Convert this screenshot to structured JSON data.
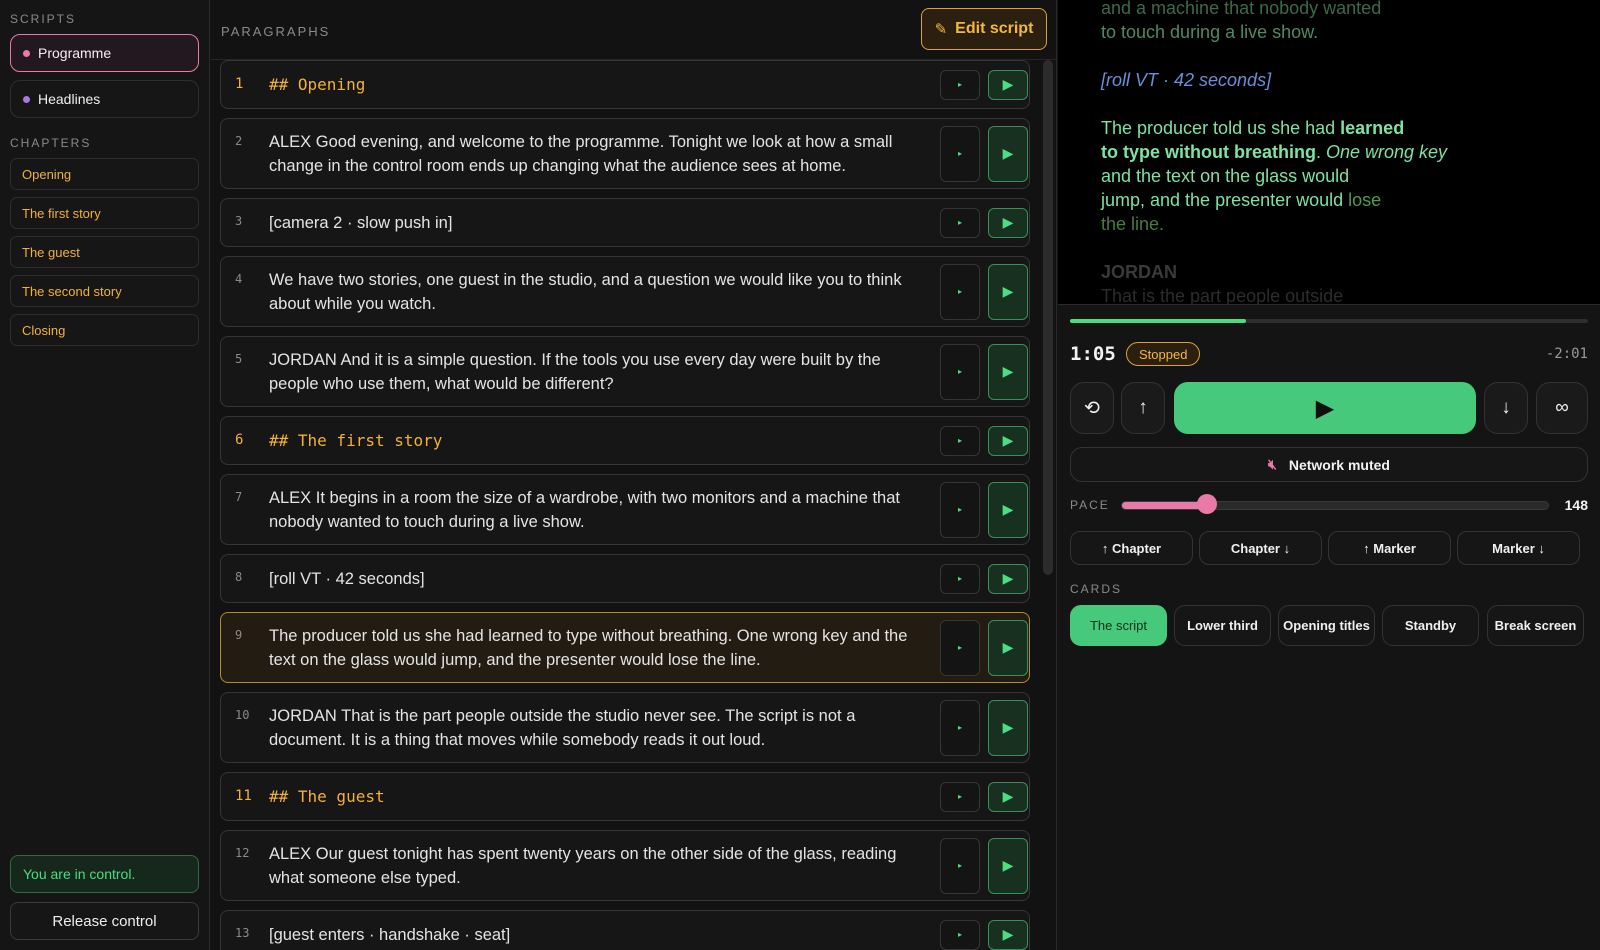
{
  "colors": {
    "accent_green": "#4ade80",
    "accent_pink": "#e879a9",
    "accent_purple": "#a678e0",
    "accent_amber": "#f2b13a",
    "background": "#121212"
  },
  "sidebar": {
    "scripts_label": "SCRIPTS",
    "scripts": [
      {
        "label": "Programme",
        "active": true,
        "dot_color": "#e879a9"
      },
      {
        "label": "Headlines",
        "active": false,
        "dot_color": "#a678e0"
      }
    ],
    "chapters_label": "CHAPTERS",
    "chapters": [
      "Opening",
      "The first story",
      "The guest",
      "The second story",
      "Closing"
    ],
    "control_message": "You are in control.",
    "release_label": "Release control"
  },
  "paragraphs": {
    "label": "PARAGRAPHS",
    "edit_label": "Edit script",
    "items": [
      {
        "num": "1",
        "text": "## Opening",
        "heading": true
      },
      {
        "num": "2",
        "text": "ALEX Good evening, and welcome to the programme. Tonight we look at how a small change in the control room ends up changing what the audience sees at home.",
        "heading": false
      },
      {
        "num": "3",
        "text": "[camera 2 · slow push in]",
        "heading": false
      },
      {
        "num": "4",
        "text": "We have two stories, one guest in the studio, and a question we would like you to think about while you watch.",
        "heading": false
      },
      {
        "num": "5",
        "text": "JORDAN And it is a simple question. If the tools you use every day were built by the people who use them, what would be different?",
        "heading": false
      },
      {
        "num": "6",
        "text": "## The first story",
        "heading": true
      },
      {
        "num": "7",
        "text": "ALEX It begins in a room the size of a wardrobe, with two monitors and a machine that nobody wanted to touch during a live show.",
        "heading": false
      },
      {
        "num": "8",
        "text": "[roll VT · 42 seconds]",
        "heading": false
      },
      {
        "num": "9",
        "text": "The producer told us she had learned to type without breathing. One wrong key and the text on the glass would jump, and the presenter would lose the line.",
        "heading": false,
        "current": true
      },
      {
        "num": "10",
        "text": "JORDAN That is the part people outside the studio never see. The script is not a document. It is a thing that moves while somebody reads it out loud.",
        "heading": false
      },
      {
        "num": "11",
        "text": "## The guest",
        "heading": true
      },
      {
        "num": "12",
        "text": "ALEX Our guest tonight has spent twenty years on the other side of the glass, reading what someone else typed.",
        "heading": false
      },
      {
        "num": "13",
        "text": "[guest enters · handshake · seat]",
        "heading": false
      }
    ]
  },
  "preview": {
    "line_top": "and a machine that nobody wanted",
    "line_top2": "to touch during a live show.",
    "cue": "[roll VT · 42 seconds]",
    "p_line1_a": "The producer told us she had ",
    "p_line1_b": "learned",
    "p_line2_a": "to type without breathing",
    "p_line2_b": ". ",
    "p_line2_c": "One wrong key",
    "p_line3": "and the text on the glass would",
    "p_line4_a": "jump, and the presenter would ",
    "p_line4_b": "lose",
    "p_line5": "the line.",
    "speaker": "JORDAN",
    "next_line": "That is the part people outside"
  },
  "transport": {
    "elapsed": "1:05",
    "status": "Stopped",
    "remaining": "-2:01",
    "progress_fraction": 0.34,
    "mute_label": "Network muted",
    "pace_label": "PACE",
    "pace_value": "148",
    "pace_fraction": 0.2,
    "nav": [
      "↑ Chapter",
      "Chapter ↓",
      "↑ Marker",
      "Marker ↓"
    ]
  },
  "cards": {
    "label": "CARDS",
    "items": [
      {
        "label": "The script",
        "active": true
      },
      {
        "label": "Lower third",
        "active": false
      },
      {
        "label": "Opening titles",
        "active": false
      },
      {
        "label": "Standby",
        "active": false
      },
      {
        "label": "Break screen",
        "active": false
      }
    ]
  },
  "icons": {
    "restart": "restart-icon",
    "up": "arrow-up-icon",
    "play": "play-icon",
    "down": "arrow-down-icon",
    "loop": "infinity-icon",
    "mute": "speaker-muted-icon",
    "edit": "pencil-icon"
  }
}
